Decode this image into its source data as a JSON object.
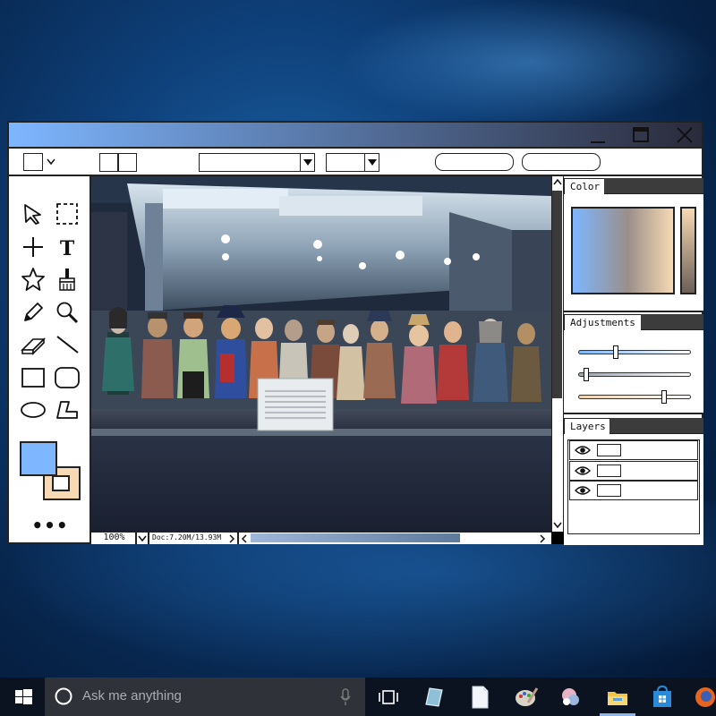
{
  "desktop": {
    "background": "#0b3a70"
  },
  "window": {
    "titlebar_gradient": [
      "#7eb6ff",
      "#2a2a3a"
    ],
    "minimize_icon": "minimize-icon",
    "maximize_icon": "maximize-icon",
    "close_icon": "close-icon"
  },
  "toolbar": {
    "items": [
      "selection-shape-dropdown",
      "view-toggle",
      "font-family-select",
      "font-size-select",
      "action-button-1",
      "action-button-2"
    ]
  },
  "tools": [
    "pointer-icon",
    "marquee-select-icon",
    "crosshair-icon",
    "text-icon",
    "star-shape-icon",
    "brush-icon",
    "pencil-icon",
    "zoom-icon",
    "eraser-icon",
    "line-icon",
    "rectangle-icon",
    "rounded-rectangle-icon",
    "ellipse-icon",
    "polygon-icon"
  ],
  "colors": {
    "foreground": "#7eb6ff",
    "background": "#f7d9b4",
    "more_label": "•••"
  },
  "status": {
    "zoom": "100%",
    "doc": "Doc:7.20M/13.93M"
  },
  "panels": {
    "color": {
      "title": "Color",
      "gradient": [
        "#7eb6ff",
        "#f7d9b4"
      ]
    },
    "adjustments": {
      "title": "Adjustments",
      "sliders": [
        {
          "name": "adjustment-slider-1",
          "value": 0.32,
          "color": "#7eb6ff"
        },
        {
          "name": "adjustment-slider-2",
          "value": 0.04,
          "color": "#9aa6b4"
        },
        {
          "name": "adjustment-slider-3",
          "value": 0.78,
          "color": "#f0d2b0"
        }
      ]
    },
    "layers": {
      "title": "Layers",
      "count": 3
    }
  },
  "taskbar": {
    "search_placeholder": "Ask me anything",
    "icons": [
      "windows-start-icon",
      "task-view-icon",
      "app-icon-1",
      "file-icon",
      "paint-icon",
      "app-icon-2",
      "file-explorer-icon",
      "store-icon",
      "firefox-icon"
    ]
  }
}
